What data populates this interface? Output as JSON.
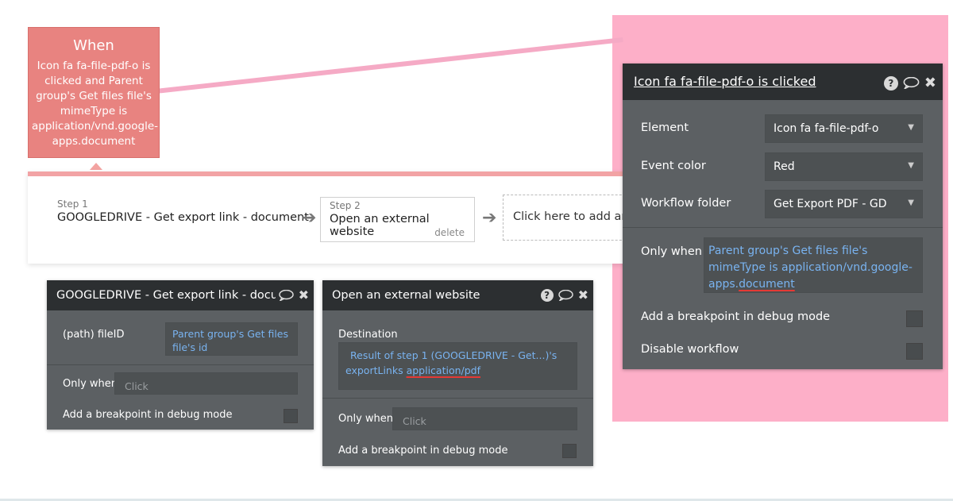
{
  "when": {
    "title": "When",
    "condition": "Icon fa fa-file-pdf-o is clicked and Parent group's Get files file's mimeType is application/vnd.google-apps.document"
  },
  "steps": {
    "step1_num": "Step 1",
    "step1_name": "GOOGLEDRIVE - Get export link - document",
    "step2_num": "Step 2",
    "step2_name": "Open an external website",
    "step2_delete": "delete",
    "add_action": "Click here to add an action..."
  },
  "panel1": {
    "title": "GOOGLEDRIVE - Get export link - document",
    "fileid_label": "(path) fileID",
    "fileid_value": "Parent group's Get files file's id",
    "only_when_label": "Only when",
    "only_when_placeholder": "Click",
    "breakpoint_label": "Add a breakpoint in debug mode"
  },
  "panel2": {
    "title": "Open an external website",
    "destination_label": "Destination",
    "destination_value_1": "Result of step 1 (GOOGLEDRIVE - Get...)'s",
    "destination_value_2": "exportLinks ",
    "destination_value_3": "application/pdf",
    "only_when_label": "Only when",
    "only_when_placeholder": "Click",
    "breakpoint_label": "Add a breakpoint in debug mode"
  },
  "event_panel": {
    "title": "Icon fa fa-file-pdf-o is clicked",
    "element_label": "Element",
    "element_value": "Icon fa fa-file-pdf-o",
    "color_label": "Event color",
    "color_value": "Red",
    "folder_label": "Workflow folder",
    "folder_value": "Get Export PDF - GD",
    "only_when_label": "Only when",
    "only_when_value_1": "Parent group's Get files file's mimeType is application/vnd.google-apps.",
    "only_when_value_2": "document",
    "breakpoint_label": "Add a breakpoint in debug mode",
    "disable_label": "Disable workflow"
  },
  "colors": {
    "when_block": "#e88380",
    "pink_overlay": "#fdafc8",
    "panel_bg": "#5c6063",
    "panel_head": "#2c2f31",
    "link_blue": "#79b3f0"
  }
}
